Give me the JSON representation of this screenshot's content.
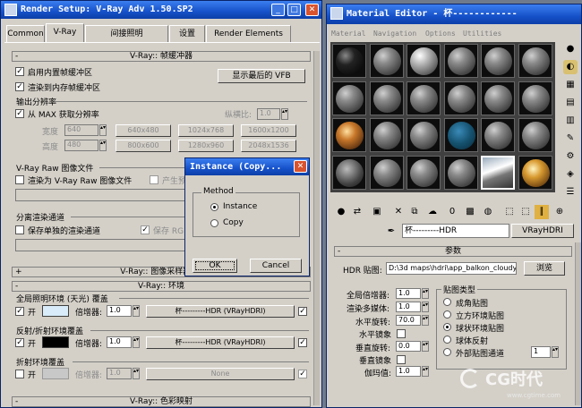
{
  "render_setup": {
    "title": "Render Setup: V-Ray Adv 1.50.SP2",
    "tabs": [
      "Common",
      "V-Ray",
      "间接照明",
      "设置",
      "Render Elements"
    ],
    "frame_buffer_header": "V-Ray:: 帧缓冲器",
    "enable_builtin_fb": "启用内置帧缓冲区",
    "render_to_memory_fb": "渲染到内存帧缓冲区",
    "show_last_vfb": "显示最后的 VFB",
    "output_res_label": "输出分辨率",
    "from_max": "从 MAX 获取分辨率",
    "aspect_label": "纵横比:",
    "aspect_value": "1.0",
    "width_label": "宽度",
    "width_value": "640",
    "height_label": "高度",
    "height_value": "480",
    "res_presets": [
      "640x480",
      "1024x768",
      "1600x1200",
      "800x600",
      "1280x960",
      "2048x1536"
    ],
    "vray_raw_label": "V-Ray Raw 图像文件",
    "render_to_raw": "渲染为 V-Ray Raw 图像文件",
    "generate_preview": "产生预",
    "split_channels_label": "分离渲染通道",
    "save_separate": "保存单独的渲染通道",
    "save_rgb": "保存 RGB",
    "sampler_header": "V-Ray:: 图像采样器(抗",
    "env_header": "V-Ray:: 环境",
    "gi_env_label": "全局照明环境 (天光) 覆盖",
    "on_label": "开",
    "multiplier_label": "倍增器:",
    "gi_multiplier": "1.0",
    "gi_map": "杯---------HDR (VRayHDRI)",
    "refl_env_label": "反射/折射环境覆盖",
    "refl_multiplier": "1.0",
    "refl_map": "杯---------HDR (VRayHDRI)",
    "refr_env_label": "折射环境覆盖",
    "refr_multiplier": "1.0",
    "refr_map": "None",
    "color_map_header": "V-Ray:: 色彩映射"
  },
  "instance_dialog": {
    "title": "Instance (Copy...",
    "method_label": "Method",
    "options": [
      "Instance",
      "Copy"
    ],
    "selected": "Instance",
    "ok": "OK",
    "cancel": "Cancel"
  },
  "material_editor": {
    "title": "Material Editor - 杯------------",
    "menu": [
      "Material",
      "Navigation",
      "Options",
      "Utilities"
    ],
    "material_name": "杯---------HDR",
    "map_type": "VRayHDRI",
    "params_header": "参数",
    "hdr_map_label": "HDR 贴图:",
    "hdr_path": "D:\\3d maps\\hdri\\app_balkon_cloudy.",
    "browse": "浏览",
    "overall_mult_label": "全局倍增器:",
    "overall_mult": "1.0",
    "render_mult_label": "渲染多媒体:",
    "render_mult": "1.0",
    "h_rotation_label": "水平旋转:",
    "h_rotation": "70.0",
    "h_flip_label": "水平镜象",
    "v_rotation_label": "垂直旋转:",
    "v_rotation": "0.0",
    "v_flip_label": "垂直镜象",
    "gamma_label": "伽玛值:",
    "gamma": "1.0",
    "map_type_group": "贴图类型",
    "map_types": [
      "成角贴图",
      "立方环境贴图",
      "球状环境贴图",
      "球体反射",
      "外部贴图通道"
    ],
    "selected_map_type": "球状环境贴图",
    "map_channel": "1"
  },
  "watermark": {
    "brand": "CG时代",
    "url": "www.cgtime.com"
  }
}
